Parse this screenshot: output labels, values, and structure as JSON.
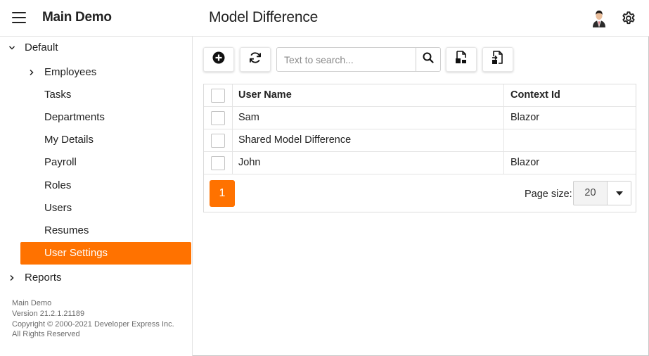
{
  "header": {
    "app_title": "Main Demo",
    "page_title": "Model Difference",
    "menu_icon": "hamburger-menu-icon",
    "avatar_icon": "user-avatar",
    "settings_icon": "gear-icon"
  },
  "sidebar": {
    "items": [
      {
        "label": "Default",
        "expanded": true
      },
      {
        "label": "Employees",
        "expanded": false
      },
      {
        "label": "Tasks"
      },
      {
        "label": "Departments"
      },
      {
        "label": "My Details"
      },
      {
        "label": "Payroll"
      },
      {
        "label": "Roles"
      },
      {
        "label": "Users"
      },
      {
        "label": "Resumes"
      },
      {
        "label": "User Settings",
        "selected": true
      },
      {
        "label": "Reports",
        "expanded": false
      }
    ],
    "footer": {
      "line1": "Main Demo",
      "line2": "Version 21.2.1.21189",
      "line3": "Copyright © 2000-2021 Developer Express Inc.",
      "line4": "All Rights Reserved"
    }
  },
  "toolbar": {
    "new_icon": "plus-circle-icon",
    "refresh_icon": "refresh-icon",
    "search_placeholder": "Text to search...",
    "search_value": "",
    "search_icon": "search-icon",
    "export_icon": "export-icon",
    "import_icon": "import-icon"
  },
  "grid": {
    "columns": [
      "User Name",
      "Context Id"
    ],
    "rows": [
      {
        "user_name": "Sam",
        "context_id": "Blazor"
      },
      {
        "user_name": "Shared Model Difference",
        "context_id": ""
      },
      {
        "user_name": "John",
        "context_id": "Blazor"
      }
    ],
    "pager": {
      "current_page": "1",
      "page_size_label": "Page size:",
      "page_size": "20"
    }
  },
  "colors": {
    "accent": "#ff7200",
    "border": "#dcdcdc",
    "text": "#222222",
    "footer_text": "#6b6b6b"
  }
}
